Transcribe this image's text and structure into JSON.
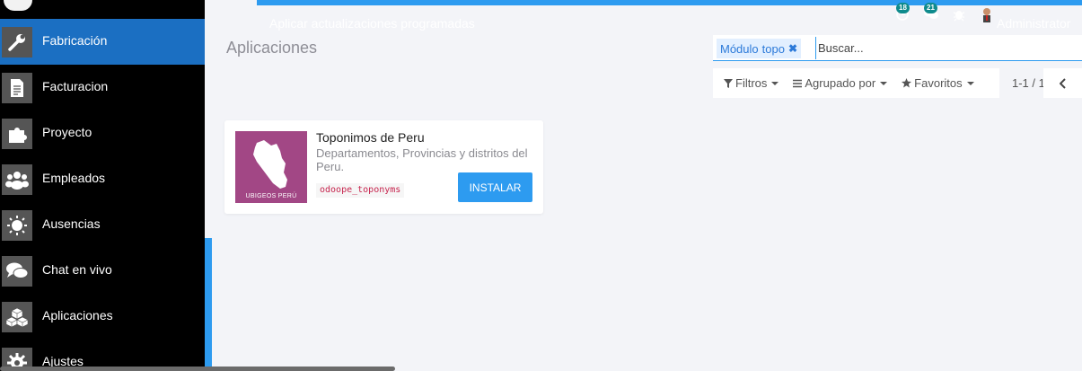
{
  "topbar": {
    "action_text": "Aplicar actualizaciones programadas",
    "activity_count": "18",
    "messages_count": "21",
    "user_name": "Administrator"
  },
  "sidebar": {
    "items": [
      {
        "label": "Fabricación",
        "icon": "wrench-icon",
        "active": true
      },
      {
        "label": "Facturacion",
        "icon": "invoice-icon",
        "active": false
      },
      {
        "label": "Proyecto",
        "icon": "puzzle-icon",
        "active": false
      },
      {
        "label": "Empleados",
        "icon": "people-icon",
        "active": false
      },
      {
        "label": "Ausencias",
        "icon": "sun-icon",
        "active": false
      },
      {
        "label": "Chat en vivo",
        "icon": "chat-icon",
        "active": false
      },
      {
        "label": "Aplicaciones",
        "icon": "cubes-icon",
        "active": false
      },
      {
        "label": "Ajustes",
        "icon": "gear-icon",
        "active": false
      }
    ],
    "active_color": "#1b6fc2"
  },
  "control_panel": {
    "breadcrumb": "Aplicaciones",
    "search": {
      "facet_field": "Módulo",
      "facet_value": "topo",
      "placeholder": "Buscar..."
    },
    "filters_label": "Filtros",
    "groupby_label": "Agrupado por",
    "favorites_label": "Favoritos",
    "pager": "1-1 / 1"
  },
  "apps": [
    {
      "name": "Toponimos de Peru",
      "summary": "Departamentos, Provincias y distritos del Peru.",
      "technical_name": "odoope_toponyms",
      "image_caption": "UBIGEOS PERÚ",
      "button_label": "INSTALAR"
    }
  ],
  "colors": {
    "primary": "#2d9bf0",
    "app_image_bg": "#a24785",
    "badge": "#0f8b8d"
  }
}
